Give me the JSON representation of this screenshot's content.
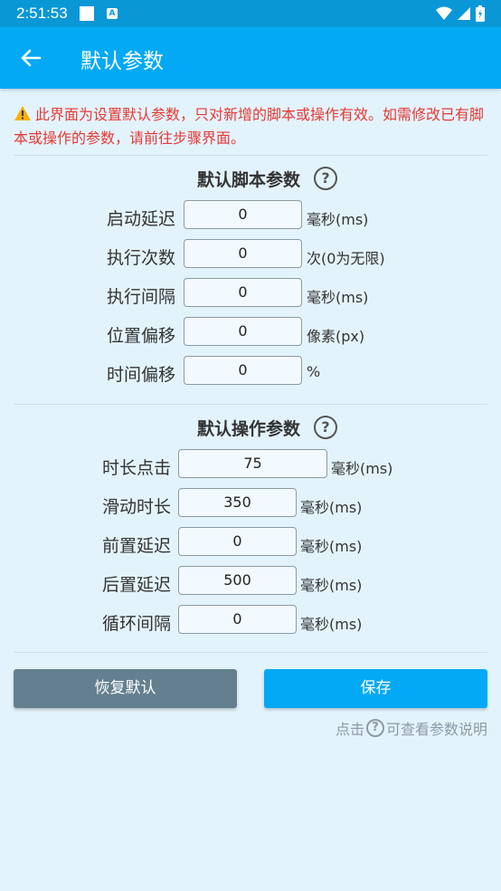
{
  "status_bar": {
    "time": "2:51:53",
    "notif_icon_letter": "A"
  },
  "app_bar": {
    "title": "默认参数"
  },
  "warning": {
    "text": "此界面为设置默认参数，只对新增的脚本或操作有效。如需修改已有脚本或操作的参数，请前往步骤界面。"
  },
  "script_section": {
    "title": "默认脚本参数",
    "help": "?",
    "rows": [
      {
        "label": "启动延迟",
        "value": "0",
        "unit": "毫秒(ms)"
      },
      {
        "label": "执行次数",
        "value": "0",
        "unit": "次(0为无限)"
      },
      {
        "label": "执行间隔",
        "value": "0",
        "unit": "毫秒(ms)"
      },
      {
        "label": "位置偏移",
        "value": "0",
        "unit": "像素(px)"
      },
      {
        "label": "时间偏移",
        "value": "0",
        "unit": "%"
      }
    ]
  },
  "op_section": {
    "title": "默认操作参数",
    "help": "?",
    "rows": [
      {
        "label": "时长点击",
        "value": "75",
        "unit": "毫秒(ms)"
      },
      {
        "label": "滑动时长",
        "value": "350",
        "unit": "毫秒(ms)"
      },
      {
        "label": "前置延迟",
        "value": "0",
        "unit": "毫秒(ms)"
      },
      {
        "label": "后置延迟",
        "value": "500",
        "unit": "毫秒(ms)"
      },
      {
        "label": "循环间隔",
        "value": "0",
        "unit": "毫秒(ms)"
      }
    ]
  },
  "buttons": {
    "reset": "恢复默认",
    "save": "保存"
  },
  "hint": {
    "before": "点击",
    "icon": "?",
    "after": "可查看参数说明"
  },
  "colors": {
    "primary": "#03a9f4",
    "status_bar": "#0a97d6",
    "warning": "#e53935",
    "reset_btn": "#64808f",
    "background": "#e3f3fc"
  }
}
